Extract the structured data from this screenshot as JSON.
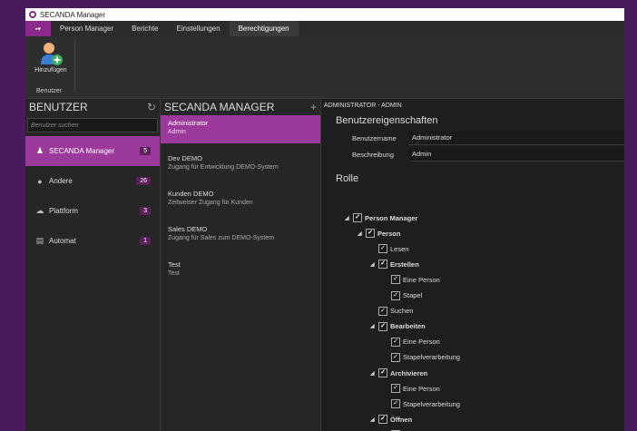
{
  "window": {
    "title": "SECANDA Manager"
  },
  "menu": {
    "app_button": "▪▾",
    "tabs": [
      "Person Manager",
      "Berichte",
      "Einstellungen",
      "Berechtigungen"
    ]
  },
  "ribbon": {
    "add_label": "Hinzufügen",
    "group_label": "Benutzer"
  },
  "users_panel": {
    "header": "BENUTZER",
    "search_placeholder": "Benutzer suchen",
    "items": [
      {
        "label": "SECANDA Manager",
        "count": "5",
        "icon": "person-icon"
      },
      {
        "label": "Andere",
        "count": "26",
        "icon": "help-circle-icon"
      },
      {
        "label": "Plattform",
        "count": "3",
        "icon": "cloud-icon"
      },
      {
        "label": "Automat",
        "count": "1",
        "icon": "document-icon"
      }
    ]
  },
  "secanda_panel": {
    "header": "SECANDA MANAGER",
    "items": [
      {
        "name": "Administrator",
        "desc": "Admin"
      },
      {
        "name": "Dev DEMO",
        "desc": "Zugang für Entwicklung DEMO-System"
      },
      {
        "name": "Kunden DEMO",
        "desc": "Zeitweiser Zugang für Kunden"
      },
      {
        "name": "Sales DEMO",
        "desc": "Zugang für Sales zum DEMO-System"
      },
      {
        "name": "Test",
        "desc": "Test"
      }
    ]
  },
  "detail": {
    "header": "ADMINISTRATOR - ADMIN",
    "properties_title": "Benutzereigenschaften",
    "username_label": "Benutzername",
    "username_value": "Administrator",
    "description_label": "Beschreibung",
    "description_value": "Admin",
    "role_title": "Rolle",
    "tree": [
      {
        "label": "Person Manager",
        "level": 0,
        "expander": true,
        "bold": true
      },
      {
        "label": "Person",
        "level": 1,
        "expander": true,
        "bold": true
      },
      {
        "label": "Lesen",
        "level": 2,
        "expander": false,
        "bold": false
      },
      {
        "label": "Erstellen",
        "level": 2,
        "expander": true,
        "bold": true
      },
      {
        "label": "Eine Person",
        "level": 3,
        "expander": false,
        "bold": false
      },
      {
        "label": "Stapel",
        "level": 3,
        "expander": false,
        "bold": false
      },
      {
        "label": "Suchen",
        "level": 2,
        "expander": false,
        "bold": false
      },
      {
        "label": "Bearbeiten",
        "level": 2,
        "expander": true,
        "bold": true
      },
      {
        "label": "Eine Person",
        "level": 3,
        "expander": false,
        "bold": false
      },
      {
        "label": "Stapelverarbeitung",
        "level": 3,
        "expander": false,
        "bold": false
      },
      {
        "label": "Archivieren",
        "level": 2,
        "expander": true,
        "bold": true
      },
      {
        "label": "Eine Person",
        "level": 3,
        "expander": false,
        "bold": false
      },
      {
        "label": "Stapelverarbeitung",
        "level": 3,
        "expander": false,
        "bold": false
      },
      {
        "label": "Öffnen",
        "level": 2,
        "expander": true,
        "bold": true
      },
      {
        "label": "Eine Person",
        "level": 3,
        "expander": false,
        "bold": false
      }
    ]
  },
  "colors": {
    "accent": "#9b3a9b",
    "background": "#4a1b5c",
    "panel": "#262626"
  }
}
